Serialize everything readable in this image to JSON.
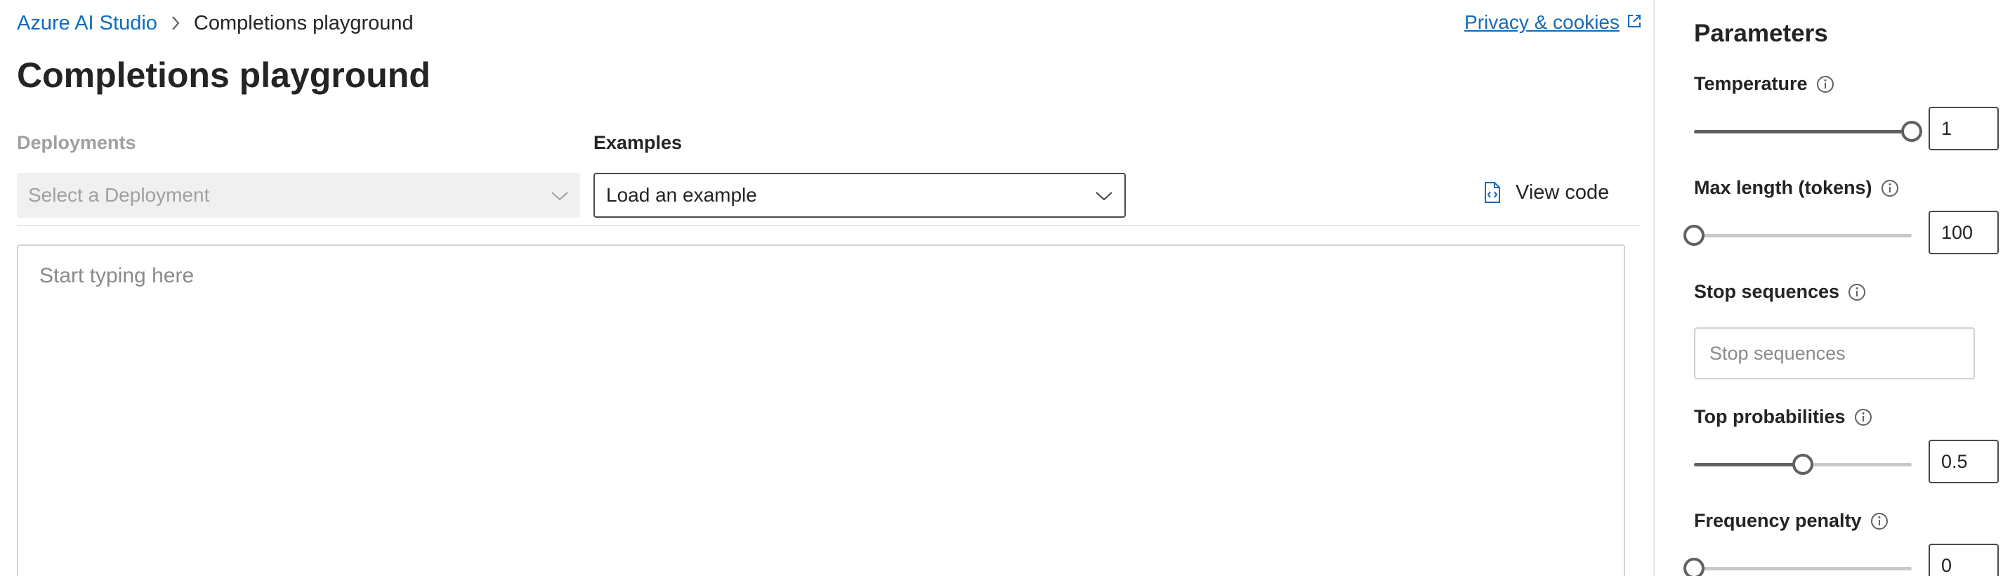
{
  "breadcrumb": {
    "root": "Azure AI Studio",
    "current": "Completions playground"
  },
  "header": {
    "privacy_link": "Privacy & cookies",
    "page_title": "Completions playground"
  },
  "deployments": {
    "label": "Deployments",
    "placeholder": "Select a Deployment"
  },
  "examples": {
    "label": "Examples",
    "placeholder": "Load an example"
  },
  "toolbar": {
    "view_code_label": "View code"
  },
  "prompt": {
    "placeholder": "Start typing here"
  },
  "parameters": {
    "title": "Parameters",
    "temperature": {
      "label": "Temperature",
      "value": "1",
      "fraction": 1.0
    },
    "max_length": {
      "label": "Max length (tokens)",
      "value": "100",
      "fraction": 0.0
    },
    "stop_sequences": {
      "label": "Stop sequences",
      "placeholder": "Stop sequences"
    },
    "top_probabilities": {
      "label": "Top probabilities",
      "value": "0.5",
      "fraction": 0.5
    },
    "frequency_penalty": {
      "label": "Frequency penalty",
      "value": "0",
      "fraction": 0.0
    }
  },
  "colors": {
    "link": "#0f6cbd",
    "text": "#242424",
    "muted": "#a0a0a0",
    "slider_active": "#616161",
    "slider_inactive": "#c8c8c8"
  },
  "icons": {
    "breadcrumb_separator": "chevron-right-icon",
    "privacy": "open-external-icon",
    "dropdown": "chevron-down-icon",
    "view_code": "code-file-icon",
    "info": "info-icon"
  }
}
